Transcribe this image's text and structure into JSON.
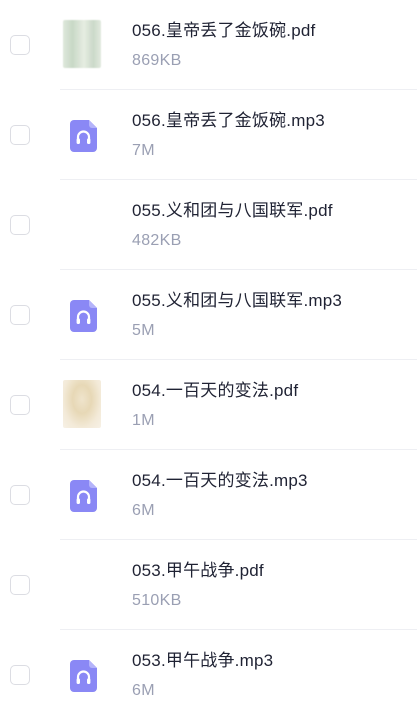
{
  "files": [
    {
      "name": "056.皇帝丢了金饭碗.pdf",
      "size": "869KB",
      "type": "pdf",
      "icon": "pdf-thumbnail"
    },
    {
      "name": "056.皇帝丢了金饭碗.mp3",
      "size": "7M",
      "type": "mp3",
      "icon": "audio-file-icon"
    },
    {
      "name": "055.义和团与八国联军.pdf",
      "size": "482KB",
      "type": "pdf",
      "icon": "pdf-thumbnail"
    },
    {
      "name": "055.义和团与八国联军.mp3",
      "size": "5M",
      "type": "mp3",
      "icon": "audio-file-icon"
    },
    {
      "name": "054.一百天的变法.pdf",
      "size": "1M",
      "type": "pdf",
      "icon": "pdf-thumbnail"
    },
    {
      "name": "054.一百天的变法.mp3",
      "size": "6M",
      "type": "mp3",
      "icon": "audio-file-icon"
    },
    {
      "name": "053.甲午战争.pdf",
      "size": "510KB",
      "type": "pdf",
      "icon": "pdf-thumbnail"
    },
    {
      "name": "053.甲午战争.mp3",
      "size": "6M",
      "type": "mp3",
      "icon": "audio-file-icon"
    }
  ],
  "colors": {
    "audio_icon": "#8a88f5",
    "text_primary": "#1f2233",
    "text_secondary": "#9a9fb3"
  }
}
